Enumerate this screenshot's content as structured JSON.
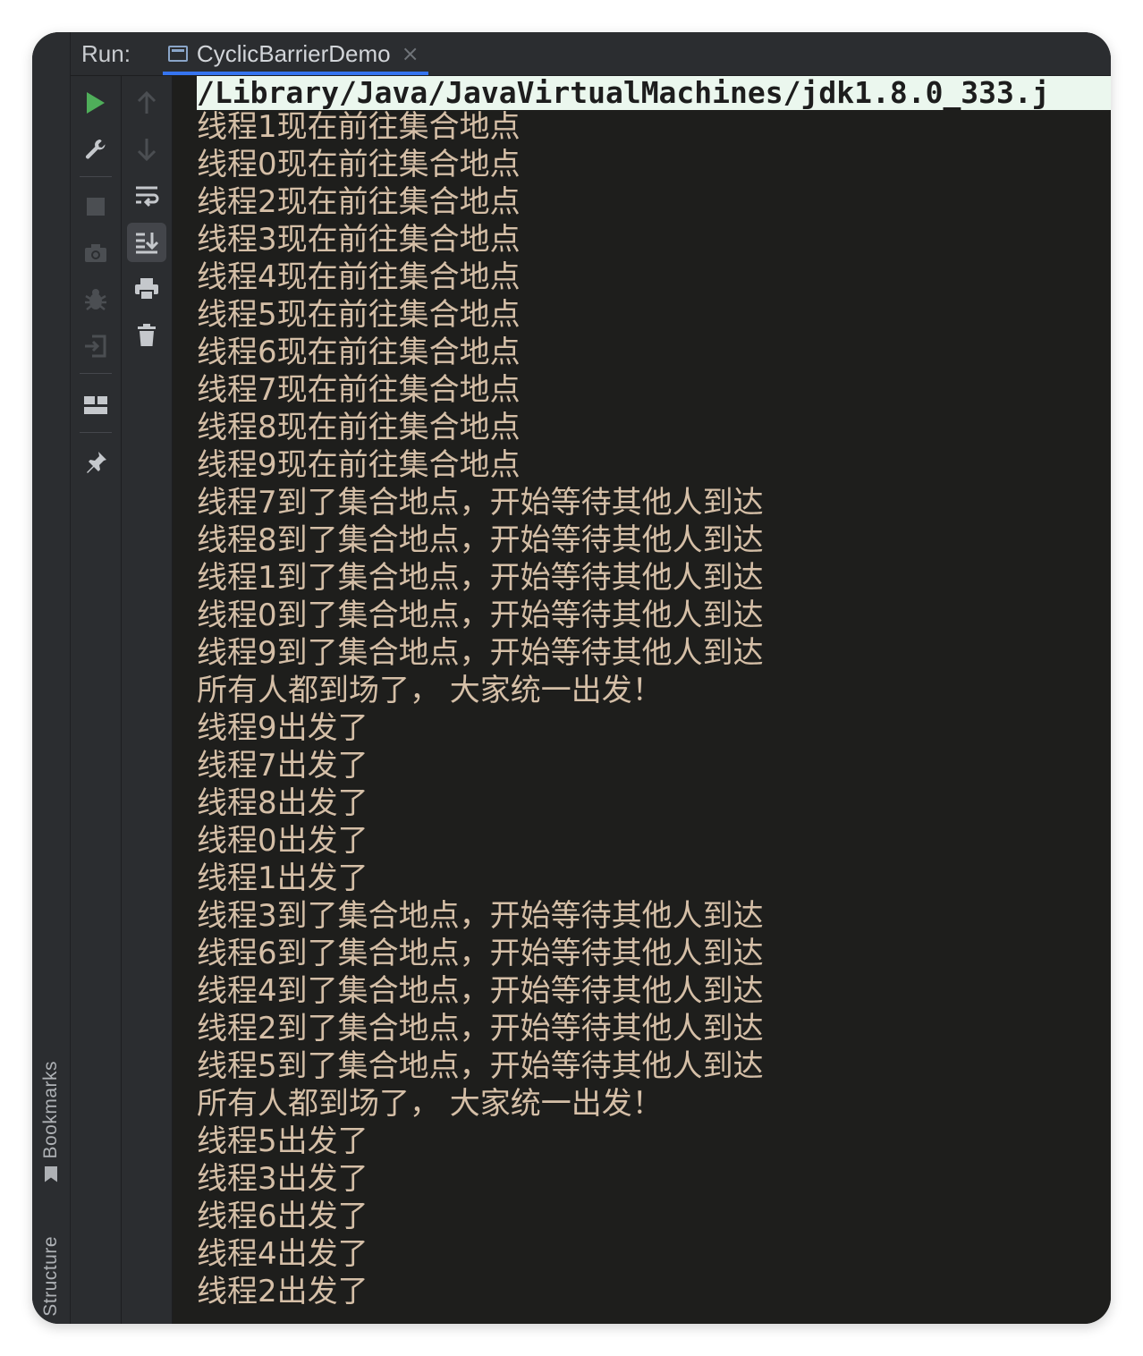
{
  "tabbar": {
    "run_label": "Run:",
    "tab_title": "CyclicBarrierDemo",
    "tab_close": "×"
  },
  "side_stripe": {
    "bookmarks_label": "Bookmarks",
    "structure_label": "Structure"
  },
  "toolbar_icons": {
    "primary": [
      "play-icon",
      "wrench-icon",
      "stop-icon",
      "camera-icon",
      "bug-icon",
      "exit-icon",
      "layout-icon",
      "pin-icon"
    ],
    "secondary": [
      "arrow-up-icon",
      "arrow-down-icon",
      "soft-wrap-icon",
      "scroll-to-end-icon",
      "print-icon",
      "trash-icon"
    ]
  },
  "colors": {
    "console_text": "#d5bfa7",
    "console_bg": "#1e1e1c",
    "command_bg": "#ebf7ee",
    "tab_underline": "#3574f0",
    "run_icon": "#4fae5a"
  },
  "console": {
    "command": "/Library/Java/JavaVirtualMachines/jdk1.8.0_333.j",
    "lines": [
      "线程1现在前往集合地点",
      "线程0现在前往集合地点",
      "线程2现在前往集合地点",
      "线程3现在前往集合地点",
      "线程4现在前往集合地点",
      "线程5现在前往集合地点",
      "线程6现在前往集合地点",
      "线程7现在前往集合地点",
      "线程8现在前往集合地点",
      "线程9现在前往集合地点",
      "线程7到了集合地点，开始等待其他人到达",
      "线程8到了集合地点，开始等待其他人到达",
      "线程1到了集合地点，开始等待其他人到达",
      "线程0到了集合地点，开始等待其他人到达",
      "线程9到了集合地点，开始等待其他人到达",
      "所有人都到场了， 大家统一出发！",
      "线程9出发了",
      "线程7出发了",
      "线程8出发了",
      "线程0出发了",
      "线程1出发了",
      "线程3到了集合地点，开始等待其他人到达",
      "线程6到了集合地点，开始等待其他人到达",
      "线程4到了集合地点，开始等待其他人到达",
      "线程2到了集合地点，开始等待其他人到达",
      "线程5到了集合地点，开始等待其他人到达",
      "所有人都到场了， 大家统一出发！",
      "线程5出发了",
      "线程3出发了",
      "线程6出发了",
      "线程4出发了",
      "线程2出发了"
    ]
  }
}
